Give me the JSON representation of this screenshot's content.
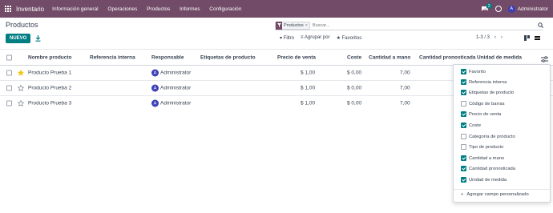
{
  "app": {
    "name": "Inventario",
    "menu": [
      "Información general",
      "Operaciones",
      "Productos",
      "Informes",
      "Configuración"
    ],
    "chat_badge": "2",
    "user": "Administrator",
    "user_initial": "A",
    "brand_color": "#714b67",
    "accent_color": "#017e84"
  },
  "page": {
    "title": "Productos",
    "new_button": "NUEVO",
    "search": {
      "facet": "Productos",
      "placeholder": "Buscar..."
    },
    "filters": [
      "Filtro",
      "Agrupar por",
      "Favoritos"
    ],
    "pager": "1-3 / 3",
    "icons": [
      "grid-apps-icon",
      "chat-icon",
      "clock-icon",
      "download-icon",
      "filter-icon",
      "search-icon",
      "kanban-view-icon",
      "list-view-icon",
      "star-icon",
      "settings-sliders-icon"
    ]
  },
  "table": {
    "headers": [
      "Nombre producto",
      "Referencia interna",
      "Responsable",
      "Etiquetas de producto",
      "Precio de venta",
      "Coste",
      "Cantidad a mano",
      "Cantidad pronosticada",
      "Unidad de medida"
    ],
    "rows": [
      {
        "favorite": true,
        "name": "Producto Prueba 1",
        "responsible": "Administrator",
        "price": "$ 1,00",
        "cost": "$ 0,00",
        "qty": "7,00"
      },
      {
        "favorite": false,
        "name": "Producto Prueba 2",
        "responsible": "Administrator",
        "price": "$ 1,00",
        "cost": "$ 0,00",
        "qty": "7,00"
      },
      {
        "favorite": false,
        "name": "Producto Prueba 3",
        "responsible": "Administrator",
        "price": "$ 1,00",
        "cost": "$ 0,00",
        "qty": "7,00"
      }
    ]
  },
  "columns_dropdown": {
    "options": [
      {
        "label": "Favorito",
        "checked": true
      },
      {
        "label": "Referencia interna",
        "checked": true
      },
      {
        "label": "Etiquetas de producto",
        "checked": true
      },
      {
        "label": "Código de barras",
        "checked": false
      },
      {
        "label": "Precio de venta",
        "checked": true
      },
      {
        "label": "Coste",
        "checked": true
      },
      {
        "label": "Categoría de producto",
        "checked": false
      },
      {
        "label": "Tipo de producto",
        "checked": false
      },
      {
        "label": "Cantidad a mano",
        "checked": true
      },
      {
        "label": "Cantidad pronosticada",
        "checked": true
      },
      {
        "label": "Unidad de medida",
        "checked": true
      }
    ],
    "add_custom": "Agregar campo personalizado"
  }
}
